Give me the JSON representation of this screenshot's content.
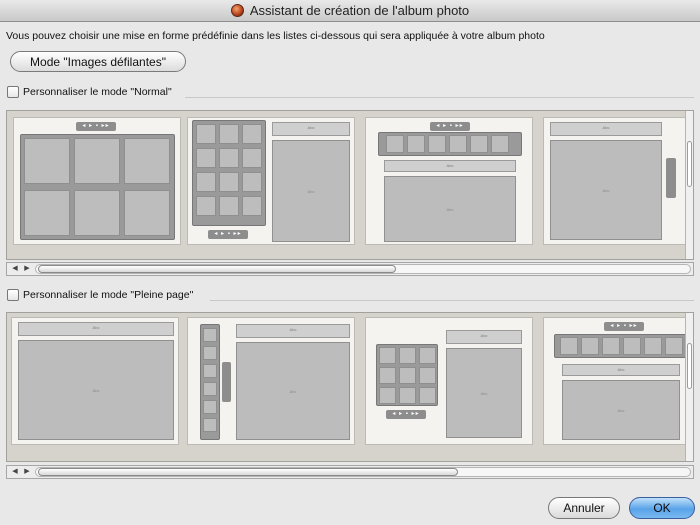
{
  "window": {
    "title": "Assistant de création de l'album photo",
    "icon": "album-app-icon"
  },
  "description": "Vous pouvez choisir une mise en forme prédéfinie dans les listes ci-dessous qui sera appliquée à votre album photo",
  "mode_button": {
    "label": "Mode \"Images défilantes\""
  },
  "sections": {
    "normal": {
      "checkbox_label": "Personnaliser le mode \"Normal\"",
      "checked": false
    },
    "fullpage": {
      "checkbox_label": "Personnaliser le mode \"Pleine page\"",
      "checked": false
    }
  },
  "thumb_text": {
    "title_abc": "Abc",
    "photo_label": "Abc"
  },
  "controls_glyph": "◂ ▸ ▪ ▸▸",
  "scroll": {
    "left": "◀",
    "right": "▶"
  },
  "buttons": {
    "cancel": "Annuler",
    "ok": "OK"
  },
  "colors": {
    "ok_button": "#5aa3e8",
    "strip_bg": "#d6d3cc"
  }
}
